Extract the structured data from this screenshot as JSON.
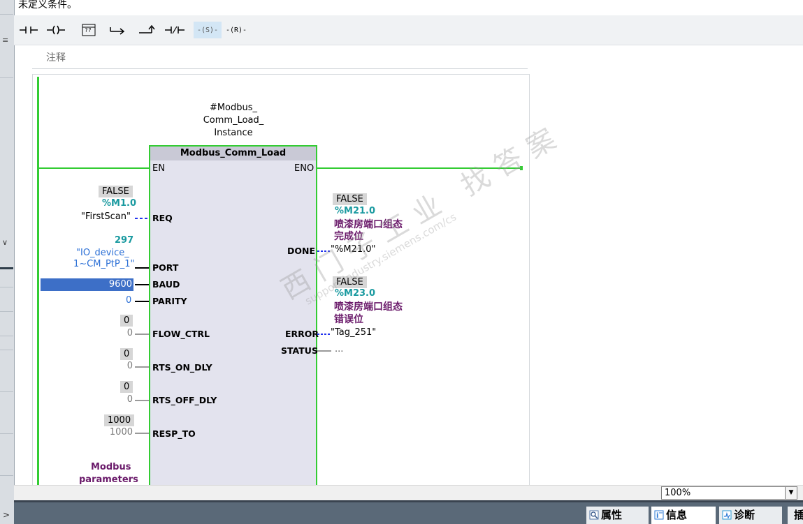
{
  "condition_text": "未定义条件。",
  "toolbar": {
    "buttons": [
      "-||-",
      "-()-",
      "[??]",
      "|->",
      "-^",
      "-|/|-",
      "-(S)-",
      "-(R)-"
    ],
    "qmark_label": "??",
    "set_label": "(S)",
    "reset_label": "(R)"
  },
  "network": {
    "comment_label": "注释",
    "instance": {
      "line1": "#Modbus_",
      "line2": "Comm_Load_",
      "line3": "Instance"
    },
    "block": {
      "title": "Modbus_Comm_Load",
      "en": "EN",
      "eno": "ENO",
      "inputs": {
        "req": "REQ",
        "port": "PORT",
        "baud": "BAUD",
        "parity": "PARITY",
        "flow_ctrl": "FLOW_CTRL",
        "rts_on_dly": "RTS_ON_DLY",
        "rts_off_dly": "RTS_OFF_DLY",
        "resp_to": "RESP_TO"
      },
      "outputs": {
        "done": "DONE",
        "error": "ERROR",
        "status": "STATUS"
      }
    },
    "req_operand": {
      "monitor": "FALSE",
      "address": "%M1.0",
      "tag": "\"FirstScan\""
    },
    "port_operand": {
      "monitor": "297",
      "tag_line1": "\"IO_device_",
      "tag_line2": "1~CM_PtP_1\""
    },
    "baud_value": "9600",
    "parity_value": "0",
    "flow_ctrl": {
      "monitor": "0",
      "value": "0"
    },
    "rts_on_dly": {
      "monitor": "0",
      "value": "0"
    },
    "rts_off_dly": {
      "monitor": "0",
      "value": "0"
    },
    "resp_to": {
      "monitor": "1000",
      "value": "1000"
    },
    "modbus_params_line1": "Modbus",
    "modbus_params_line2": "parameters",
    "done_operand": {
      "monitor": "FALSE",
      "address": "%M21.0",
      "comment_line1": "喷漆房端口组态",
      "comment_line2": "完成位",
      "tag": "\"%M21.0\""
    },
    "error_operand": {
      "monitor": "FALSE",
      "address": "%M23.0",
      "comment_line1": "喷漆房端口组态",
      "comment_line2": "错误位",
      "tag": "\"Tag_251\""
    },
    "status_operand": "..."
  },
  "watermark": {
    "big": "西门子工业 找答案",
    "small": "support.industry.siemens.com/cs"
  },
  "zoom": {
    "value": "100%"
  },
  "tabs": [
    {
      "label": "属性",
      "icon": "properties-icon"
    },
    {
      "label": "信息",
      "icon": "info-icon"
    },
    {
      "label": "诊断",
      "icon": "diagnostics-icon"
    },
    {
      "label": "插"
    }
  ]
}
